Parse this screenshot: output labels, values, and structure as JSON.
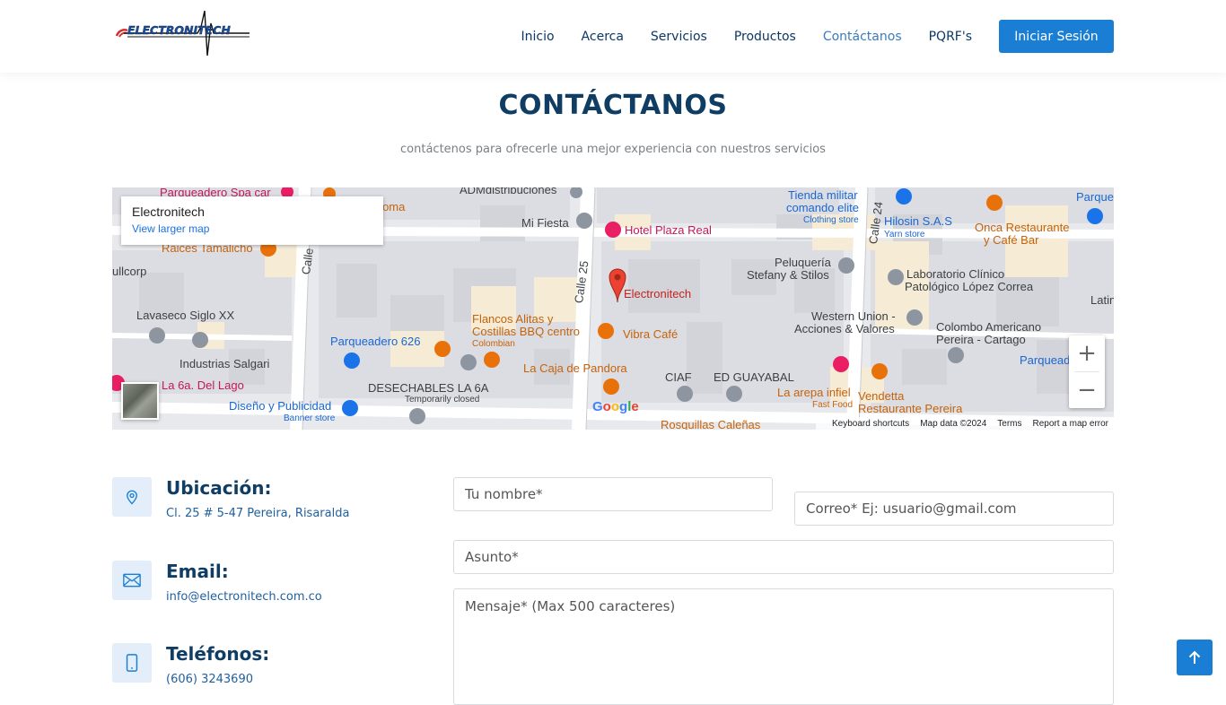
{
  "brand": {
    "logo_text": "ELECTRONITECH"
  },
  "nav": {
    "items": [
      "Inicio",
      "Acerca",
      "Servicios",
      "Productos",
      "Contáctanos",
      "PQRF's"
    ],
    "active": "Contáctanos",
    "login_label": "Iniciar Sesión"
  },
  "section": {
    "title": "CONTÁCTANOS",
    "subtitle": "contáctenos para ofrecerle una mejor experiencia con nuestros servicios"
  },
  "map": {
    "card_title": "Electronitech",
    "card_link": "View larger map",
    "pin_label": "Electronitech",
    "google": "Google",
    "attribution": [
      "Keyboard shortcuts",
      "Map data ©2024",
      "Terms",
      "Report a map error"
    ],
    "zoom_in": "+",
    "zoom_out": "−",
    "labels": {
      "parqueadero_spa": "Parqueadero Spa car",
      "la_loma": "a Loma",
      "admdistribuciones": "ADMdistribuciones",
      "mi_fiesta": "Mi Fiesta",
      "hotel_plaza": "Hotel Plaza Real",
      "tienda_militar": "Tienda militar",
      "comando_elite": "comando elite",
      "clothing_store": "Clothing store",
      "hilosin": "Hilosin S.A.S",
      "yarn_store": "Yarn store",
      "onca": "Onca Restaurante",
      "cafe_bar": "y Café Bar",
      "parque_r": "Parque",
      "raices": "Raices Tamalicho",
      "ullcorp": "ullcorp",
      "peluqueria": "Peluquería",
      "stefany": "Stefany & Stilos",
      "laboratorio": "Laboratorio Clínico",
      "patologico": "Patológico López Correa",
      "latin": "Latin",
      "lavaseco": "Lavaseco Siglo XX",
      "flancos": "Flancos Alitas y",
      "costillas": "Costillas BBQ centro",
      "colombian": "Colombian",
      "vibra": "Vibra Café",
      "western": "Western Union -",
      "acciones": "Acciones & Valores",
      "colombo": "Colombo Americano",
      "pereira_cartago": "Pereira - Cartago",
      "industrias": "Industrias Salgari",
      "parqueadero626": "Parqueadero 626",
      "caja_pandora": "La Caja de Pandora",
      "parquead_r": "Parquead",
      "la6a": "La 6a. Del Lago",
      "desechables": "DESECHABLES LA 6A",
      "temp_closed": "Temporarily closed",
      "ciaf": "CIAF",
      "ed_guayabal": "ED GUAYABAL",
      "arepa": "La arepa infiel",
      "fast_food": "Fast Food",
      "vendetta": "Vendetta",
      "vendetta2": "Restaurante Pereira",
      "diseno": "Diseño y Publicidad",
      "banner": "Banner store",
      "rosquillas": "Rosquillas Caleñas",
      "calle25": "Calle 25",
      "calle24": "Calle 24",
      "calle_left": "Calle"
    }
  },
  "contact": {
    "location_title": "Ubicación:",
    "location_value": "Cl. 25 # 5-47 Pereira, Risaralda",
    "email_title": "Email:",
    "email_value": "info@electronitech.com.co",
    "phone_title": "Teléfonos:",
    "phone_value": "(606) 3243690"
  },
  "form": {
    "name_placeholder": "Tu nombre*",
    "email_placeholder": "Correo* Ej: usuario@gmail.com",
    "subject_placeholder": "Asunto*",
    "message_placeholder": "Mensaje* (Max 500 caracteres)"
  },
  "colors": {
    "primary": "#1a7fd4",
    "heading": "#0f3d63",
    "nav": "#0b3866",
    "nav_active": "#3a7bbf",
    "icon_bg": "#e3eefa"
  },
  "icons": {
    "location": "map-pin-icon",
    "email": "envelope-icon",
    "phone": "phone-icon",
    "back_top": "arrow-up-icon"
  }
}
